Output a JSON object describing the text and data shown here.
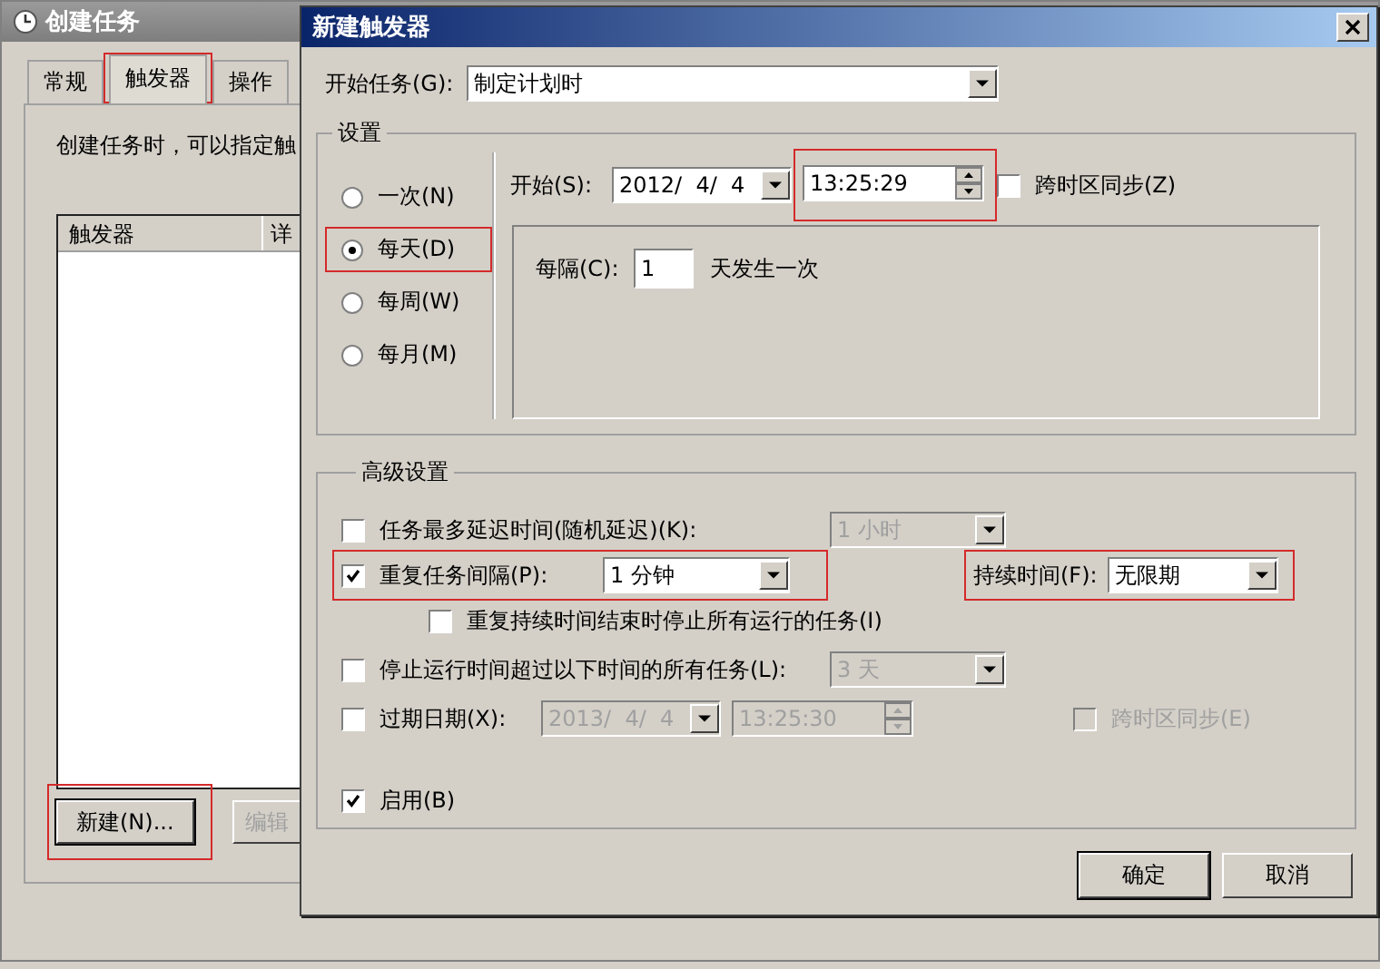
{
  "parent_window": {
    "title": "创建任务",
    "tabs": [
      {
        "label": "常规",
        "selected": false,
        "highlighted": false
      },
      {
        "label": "触发器",
        "selected": true,
        "highlighted": true
      },
      {
        "label": "操作",
        "selected": false,
        "highlighted": false
      }
    ],
    "description": "创建任务时，可以指定触",
    "list": {
      "columns": [
        "触发器",
        "详"
      ]
    },
    "buttons": [
      {
        "label": "新建(N)...",
        "disabled": false,
        "highlighted": true
      },
      {
        "label": "编辑",
        "disabled": true,
        "highlighted": false
      }
    ]
  },
  "dialog": {
    "title": "新建触发器",
    "begin_task": {
      "label": "开始任务(G):",
      "value": "制定计划时"
    },
    "settings": {
      "title": "设置",
      "schedules": [
        {
          "label": "一次(N)",
          "selected": false,
          "highlighted": false
        },
        {
          "label": "每天(D)",
          "selected": true,
          "highlighted": true
        },
        {
          "label": "每周(W)",
          "selected": false,
          "highlighted": false
        },
        {
          "label": "每月(M)",
          "selected": false,
          "highlighted": false
        }
      ],
      "start": {
        "label": "开始(S):",
        "date": "2012/  4/  4",
        "time": "13:25:29",
        "time_highlighted": true
      },
      "sync_timezone": {
        "label": "跨时区同步(Z)",
        "checked": false
      },
      "recur": {
        "label": "每隔(C):",
        "value": "1",
        "suffix": "天发生一次"
      }
    },
    "advanced": {
      "title": "高级设置",
      "delay": {
        "label": "任务最多延迟时间(随机延迟)(K):",
        "checked": false,
        "value": "1 小时"
      },
      "repeat": {
        "label": "重复任务间隔(P):",
        "checked": true,
        "value": "1 分钟",
        "highlighted": true,
        "duration": {
          "label": "持续时间(F):",
          "value": "无限期",
          "highlighted": true
        }
      },
      "stop_at_end": {
        "label": "重复持续时间结束时停止所有运行的任务(I)",
        "checked": false
      },
      "stop_longer": {
        "label": "停止运行时间超过以下时间的所有任务(L):",
        "checked": false,
        "value": "3 天"
      },
      "expire": {
        "label": "过期日期(X):",
        "checked": false,
        "date": "2013/  4/  4",
        "time": "13:25:30",
        "sync": {
          "label": "跨时区同步(E)",
          "checked": false
        }
      },
      "enabled": {
        "label": "启用(B)",
        "checked": true
      }
    },
    "buttons": [
      {
        "label": "确定",
        "default": true
      },
      {
        "label": "取消",
        "default": false
      }
    ]
  }
}
